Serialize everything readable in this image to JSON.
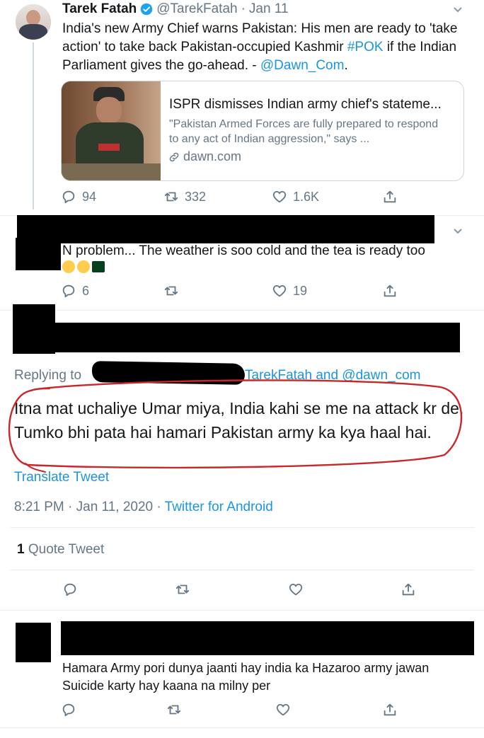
{
  "tweet1": {
    "name": "Tarek Fatah",
    "handle": "@TarekFatah",
    "dot": "·",
    "date": "Jan 11",
    "text_a": "India's new Army Chief warns Pakistan: His men are ready to 'take action' to take back Pakistan-occupied Kashmir ",
    "hashtag": "#POK",
    "text_b": " if the Indian Parliament gives the go-ahead.  - ",
    "mention": "@Dawn_Com",
    "text_c": ".",
    "card": {
      "title": "ISPR dismisses Indian army chief's stateme...",
      "desc": "\"Pakistan Armed Forces are fully prepared to respond to any act of Indian aggression,\" says ...",
      "domain": "dawn.com"
    },
    "replies": "94",
    "retweets": "332",
    "likes": "1.6K"
  },
  "tweet2": {
    "text": "N problem... The weather is soo cold and the tea is ready too",
    "replies": "6",
    "likes": "19"
  },
  "main_tweet": {
    "replying_prefix": "Replying to ",
    "replying_suffix": "TarekFatah and @dawn_com",
    "text": "Itna mat uchaliye Umar miya, India kahi se me na attack kr de. Tumko bhi pata hai hamari Pakistan army ka kya haal hai.",
    "translate": "Translate Tweet",
    "timestamp": "8:21 PM · Jan 11, 2020 · ",
    "source": "Twitter for Android",
    "quote_count": "1",
    "quote_label": " Quote Tweet"
  },
  "tweet4": {
    "text": "Hamara Army pori dunya jaanti hay india ka Hazaroo army jawan Suicide karty hay kaana na milny per"
  },
  "colors": {
    "link": "#1b95e0",
    "verified": "#1da1f2",
    "circle": "#c8282a"
  },
  "icons": [
    "reply-icon",
    "retweet-icon",
    "like-icon",
    "share-icon",
    "chevron-down-icon",
    "verified-icon",
    "link-icon"
  ]
}
